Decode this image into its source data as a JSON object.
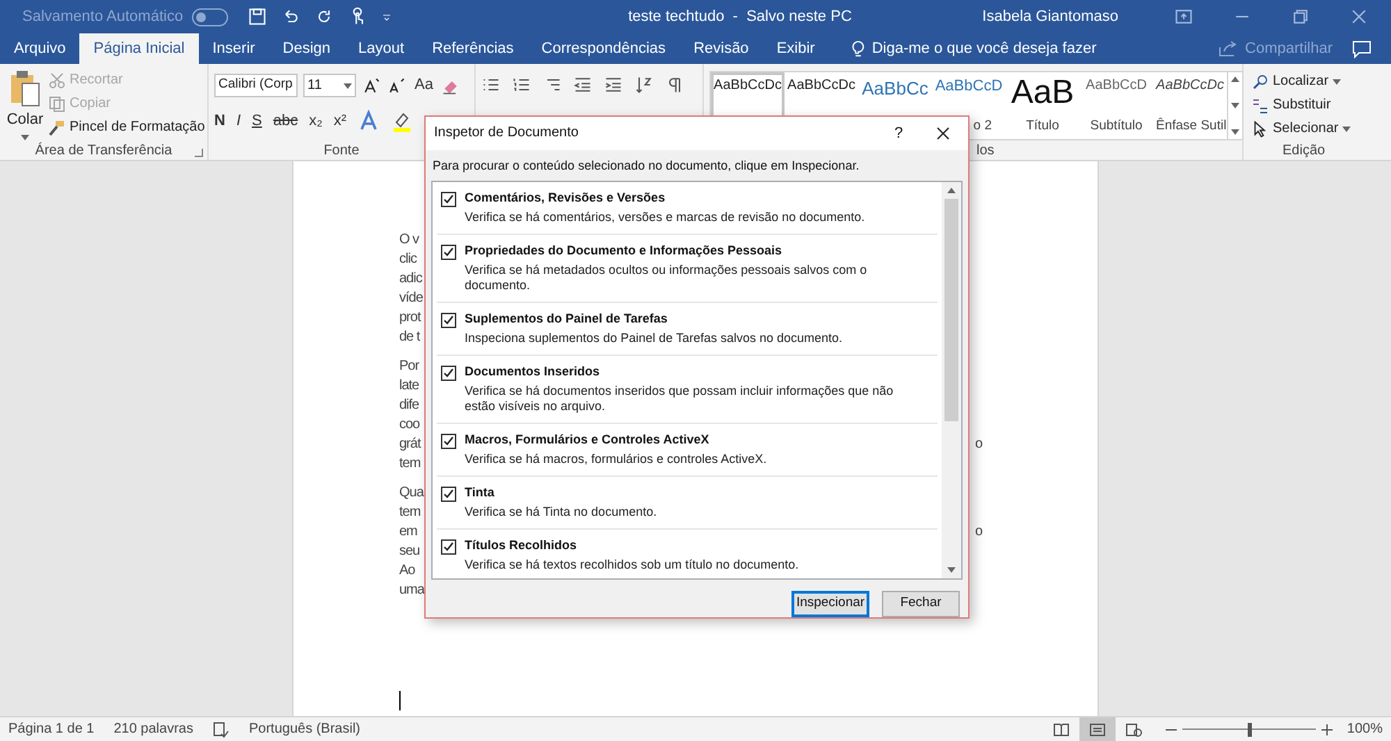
{
  "title_bar": {
    "autosave_label": "Salvamento Automático",
    "autosave_on": false,
    "document_title": "teste techtudo  -  Salvo neste PC",
    "user": "Isabela Giantomaso"
  },
  "tabs": [
    {
      "label": "Arquivo",
      "selected": false
    },
    {
      "label": "Página Inicial",
      "selected": true
    },
    {
      "label": "Inserir",
      "selected": false
    },
    {
      "label": "Design",
      "selected": false
    },
    {
      "label": "Layout",
      "selected": false
    },
    {
      "label": "Referências",
      "selected": false
    },
    {
      "label": "Correspondências",
      "selected": false
    },
    {
      "label": "Revisão",
      "selected": false
    },
    {
      "label": "Exibir",
      "selected": false
    }
  ],
  "tell_me": "Diga-me o que você deseja fazer",
  "share": "Compartilhar",
  "clipboard": {
    "paste": "Colar",
    "actions": [
      {
        "kind": "cut",
        "label": "Recortar",
        "disabled": true
      },
      {
        "kind": "copy",
        "label": "Copiar",
        "disabled": true
      },
      {
        "kind": "painter",
        "label": "Pincel de Formatação",
        "disabled": false
      }
    ],
    "group_label": "Área de Transferência"
  },
  "font": {
    "font_name": "Calibri (Corp",
    "font_size": "11",
    "change_case": "Aa",
    "format_buttons": [
      "N",
      "I",
      "S",
      "abc",
      "x₂",
      "x²"
    ],
    "group_label": "Fonte"
  },
  "styles": {
    "items": [
      {
        "sample": "AaBbCcDc",
        "kind": "normal",
        "selected": true
      },
      {
        "sample": "AaBbCcDc",
        "kind": "normal",
        "selected": false
      },
      {
        "sample": "AaBbCc",
        "kind": "heading1",
        "selected": false
      },
      {
        "sample": "AaBbCcD",
        "kind": "heading2",
        "caption": "o 2",
        "selected": false
      },
      {
        "sample": "AaB",
        "kind": "title",
        "caption": "Título",
        "selected": false
      },
      {
        "sample": "AaBbCcD",
        "kind": "subtitle",
        "caption": "Subtítulo",
        "selected": false
      },
      {
        "sample": "AaBbCcDc",
        "kind": "emphasis",
        "caption": "Ênfase Sutil",
        "selected": false
      }
    ],
    "group_label": "los"
  },
  "editing": {
    "actions": [
      {
        "kind": "find",
        "label": "Localizar"
      },
      {
        "kind": "replace",
        "label": "Substituir"
      },
      {
        "kind": "select",
        "label": "Selecionar"
      }
    ],
    "group_label": "Edição"
  },
  "document": {
    "paragraphs": [
      {
        "lines": [
          {
            "left": "O v"
          },
          {
            "left": "clic"
          },
          {
            "left": "adic"
          },
          {
            "left": "víde"
          },
          {
            "left": "prot"
          },
          {
            "left": "de t"
          }
        ]
      },
      {
        "lines": [
          {
            "left": "Por"
          },
          {
            "left": "late"
          },
          {
            "left": "dife"
          },
          {
            "left": "coo"
          },
          {
            "left": "grát",
            "right": "o"
          },
          {
            "left": "tem"
          }
        ]
      },
      {
        "lines": [
          {
            "left": "Qua"
          },
          {
            "left": "tem"
          },
          {
            "left": "em",
            "right": "o"
          },
          {
            "left": "seu"
          },
          {
            "left": "Ao"
          },
          {
            "left": "uma"
          }
        ]
      }
    ]
  },
  "dialog": {
    "title": "Inspetor de Documento",
    "help": "?",
    "instruction": "Para procurar o conteúdo selecionado no documento, clique em Inspecionar.",
    "items": [
      {
        "title": "Comentários, Revisões e Versões",
        "description": "Verifica se há comentários, versões e marcas de revisão no documento.",
        "checked": true
      },
      {
        "title": "Propriedades do Documento e Informações Pessoais",
        "description": "Verifica se há metadados ocultos ou informações pessoais salvos com o documento.",
        "checked": true
      },
      {
        "title": "Suplementos do Painel de Tarefas",
        "description": "Inspeciona suplementos do Painel de Tarefas salvos no documento.",
        "checked": true
      },
      {
        "title": "Documentos Inseridos",
        "description": "Verifica se há documentos inseridos que possam incluir informações que não estão visíveis no arquivo.",
        "checked": true
      },
      {
        "title": "Macros, Formulários e Controles ActiveX",
        "description": "Verifica se há macros, formulários e controles ActiveX.",
        "checked": true
      },
      {
        "title": "Tinta",
        "description": "Verifica se há Tinta no documento.",
        "checked": true
      },
      {
        "title": "Títulos Recolhidos",
        "description": "Verifica se há textos recolhidos sob um título no documento.",
        "checked": true
      }
    ],
    "buttons": [
      {
        "label": "Inspecionar",
        "default": true
      },
      {
        "label": "Fechar",
        "default": false
      }
    ]
  },
  "status_bar": {
    "page": "Página 1 de 1",
    "words": "210 palavras",
    "language": "Português (Brasil)",
    "views": [
      {
        "kind": "read",
        "selected": false
      },
      {
        "kind": "print",
        "selected": true
      },
      {
        "kind": "web",
        "selected": false
      }
    ],
    "zoom": {
      "level": 0.5
    },
    "zoom_label": "100%"
  }
}
